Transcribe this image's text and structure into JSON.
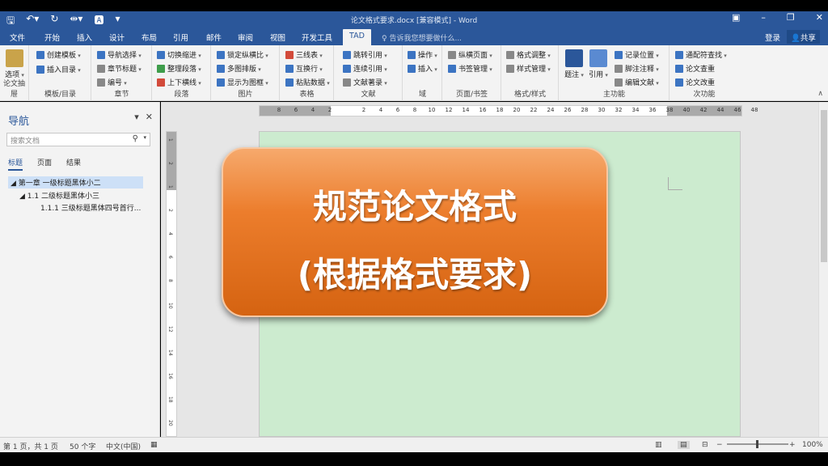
{
  "window": {
    "title": "论文格式要求.docx [兼容模式] - Word",
    "qat": [
      "save-icon",
      "undo-icon",
      "redo-icon",
      "layout-icon",
      "textbox-icon",
      "customize-icon"
    ],
    "controls": [
      "ribbon-display-icon",
      "minimize-icon",
      "restore-icon",
      "close-icon"
    ]
  },
  "tabs": [
    "文件",
    "开始",
    "插入",
    "设计",
    "布局",
    "引用",
    "邮件",
    "审阅",
    "视图",
    "开发工具",
    "TAD"
  ],
  "active_tab": "TAD",
  "tell_me": "告诉我您想要做什么...",
  "login": "登录",
  "share": "共享",
  "ribbon": {
    "g1": {
      "name": "论文抽屉",
      "big": "选项"
    },
    "g2": {
      "name": "模板/目录",
      "items": [
        "创建模板",
        "插入目录"
      ]
    },
    "g3": {
      "name": "章节",
      "items": [
        "导航选择",
        "章节标题",
        "编号"
      ]
    },
    "g4": {
      "name": "段落",
      "items": [
        "切换缩进",
        "整理段落",
        "上下横线"
      ]
    },
    "g5": {
      "name": "图片",
      "items": [
        "锁定纵横比",
        "多图排版",
        "显示为图框"
      ]
    },
    "g6": {
      "name": "表格",
      "items": [
        "三线表",
        "互换行",
        "粘贴数据"
      ]
    },
    "g7": {
      "name": "文献",
      "items": [
        "跳转引用",
        "连续引用",
        "文献著录"
      ]
    },
    "g8": {
      "name": "域",
      "items": [
        "操作",
        "插入"
      ]
    },
    "g9": {
      "name": "页面/书签",
      "items": [
        "纵横页面",
        "书签管理"
      ]
    },
    "g10": {
      "name": "格式/样式",
      "items": [
        "格式调整",
        "样式管理"
      ]
    },
    "g11": {
      "name": "主功能",
      "bigs": [
        "题注",
        "引用"
      ],
      "items": [
        "记录位置",
        "脚注注释",
        "编辑文献"
      ]
    },
    "g12": {
      "name": "次功能",
      "items": [
        "通配符查找",
        "论文查重",
        "论文改重"
      ]
    }
  },
  "nav": {
    "title": "导航",
    "search_placeholder": "搜索文档",
    "tabs": [
      "标题",
      "页面",
      "结果"
    ],
    "headings": [
      "第一章 一级标题黑体小二",
      "1.1 二级标题黑体小三",
      "1.1.1 三级标题黑体四号首行..."
    ]
  },
  "ruler_h": [
    "8",
    "6",
    "4",
    "2",
    "",
    "2",
    "4",
    "6",
    "8",
    "10",
    "12",
    "14",
    "16",
    "18",
    "20",
    "22",
    "24",
    "26",
    "28",
    "30",
    "32",
    "34",
    "36",
    "38",
    "40",
    "42",
    "44",
    "46",
    "48"
  ],
  "ruler_v": [
    "1",
    "2",
    "1",
    "2",
    "4",
    "6",
    "8",
    "10",
    "12",
    "14",
    "16",
    "18",
    "20"
  ],
  "banner": {
    "line1": "规范论文格式",
    "line2": "(根据格式要求)"
  },
  "status": {
    "page": "第 1 页，共 1 页",
    "words": "50 个字",
    "lang": "中文(中国)",
    "zoom": "100%"
  }
}
